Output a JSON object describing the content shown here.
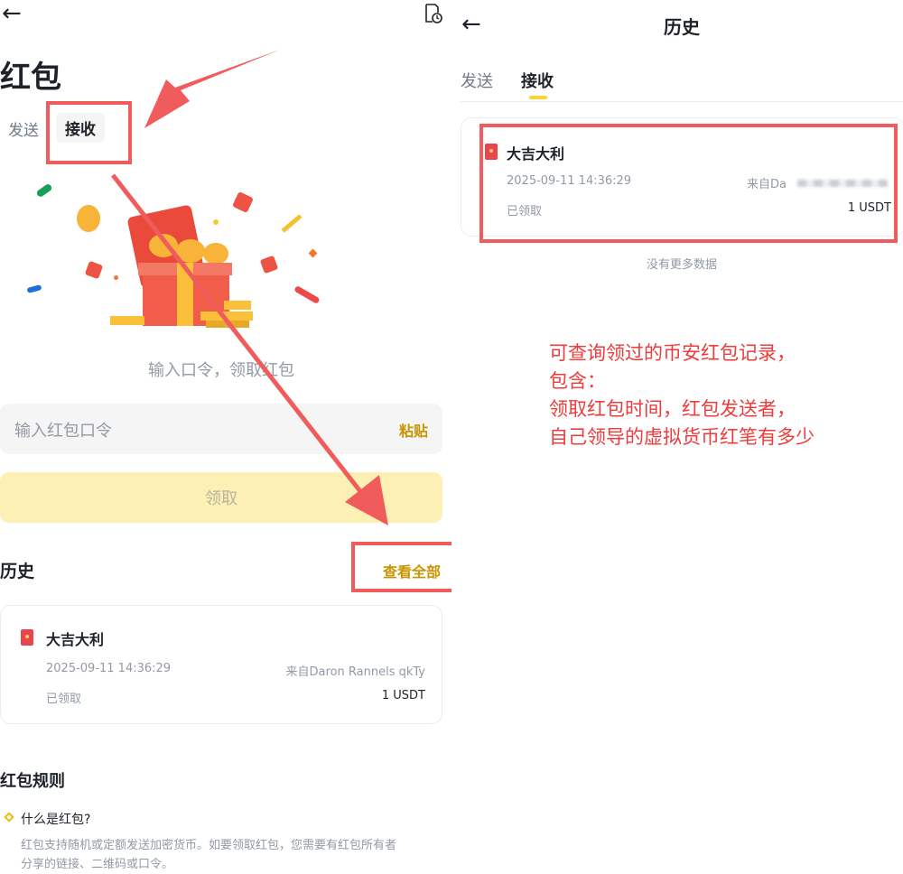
{
  "left": {
    "page_title": "红包",
    "tabs": [
      {
        "label": "发送"
      },
      {
        "label": "接收"
      }
    ],
    "prompt_text": "输入口令，领取红包",
    "code_input": {
      "placeholder": "输入红包口令",
      "paste_label": "粘贴"
    },
    "claim_button": "领取",
    "history": {
      "title": "历史",
      "view_all": "查看全部",
      "record": {
        "title": "大吉大利",
        "time": "2025-09-11 14:36:29",
        "from": "来自Daron Rannels qkTy",
        "status": "已领取",
        "amount": "1 USDT"
      }
    },
    "rules": {
      "title": "红包规则",
      "q1": "什么是红包?",
      "a1_line1": "红包支持随机或定额发送加密货币。如要领取红包，您需要有红包所有者",
      "a1_line2": "分享的链接、二维码或口令。"
    }
  },
  "right": {
    "page_title": "历史",
    "tabs": [
      {
        "label": "发送"
      },
      {
        "label": "接收"
      }
    ],
    "record": {
      "title": "大吉大利",
      "time": "2025-09-11 14:36:29",
      "from": "来自Da",
      "status": "已领取",
      "amount": "1 USDT"
    },
    "no_more": "没有更多数据"
  },
  "annotation": {
    "lines": [
      "可查询领过的币安红包记录，",
      "包含：",
      "领取红包时间，红包发送者，",
      "自己领导的虚拟货币红笔有多少"
    ]
  },
  "colors": {
    "accent_yellow": "#fcd535",
    "link_yellow": "#c99400",
    "annotation_red": "#f05c5c",
    "red_packet": "#e8464c"
  }
}
